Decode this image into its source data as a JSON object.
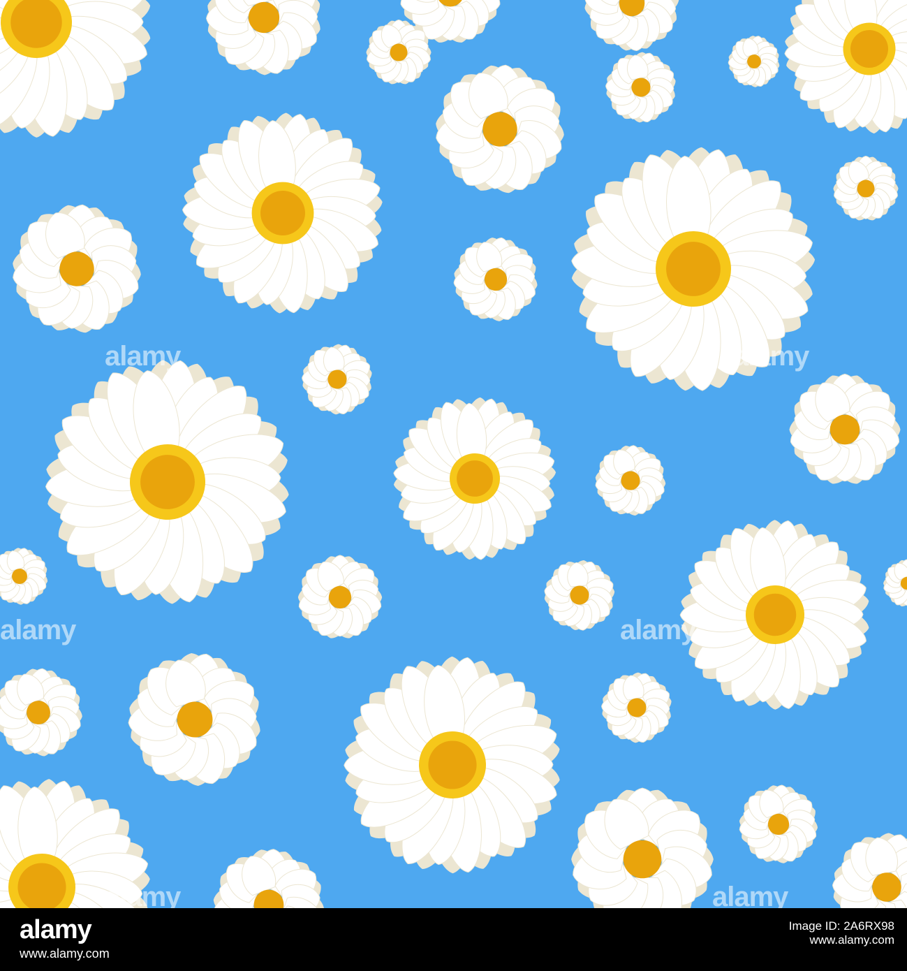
{
  "image": {
    "background_color": "#4ea8f0",
    "petal_color": "#ffffff",
    "petal_shade_color": "#ece6d2",
    "center_color": "#e9a40c",
    "center_ring_color": "#f6c71a",
    "watermark_text": "alamy"
  },
  "footer": {
    "logo_text": "alamy",
    "left_text": "www.alamy.com",
    "right_line1": "Image ID: 2A6RX98",
    "right_line2": "www.alamy.com"
  }
}
